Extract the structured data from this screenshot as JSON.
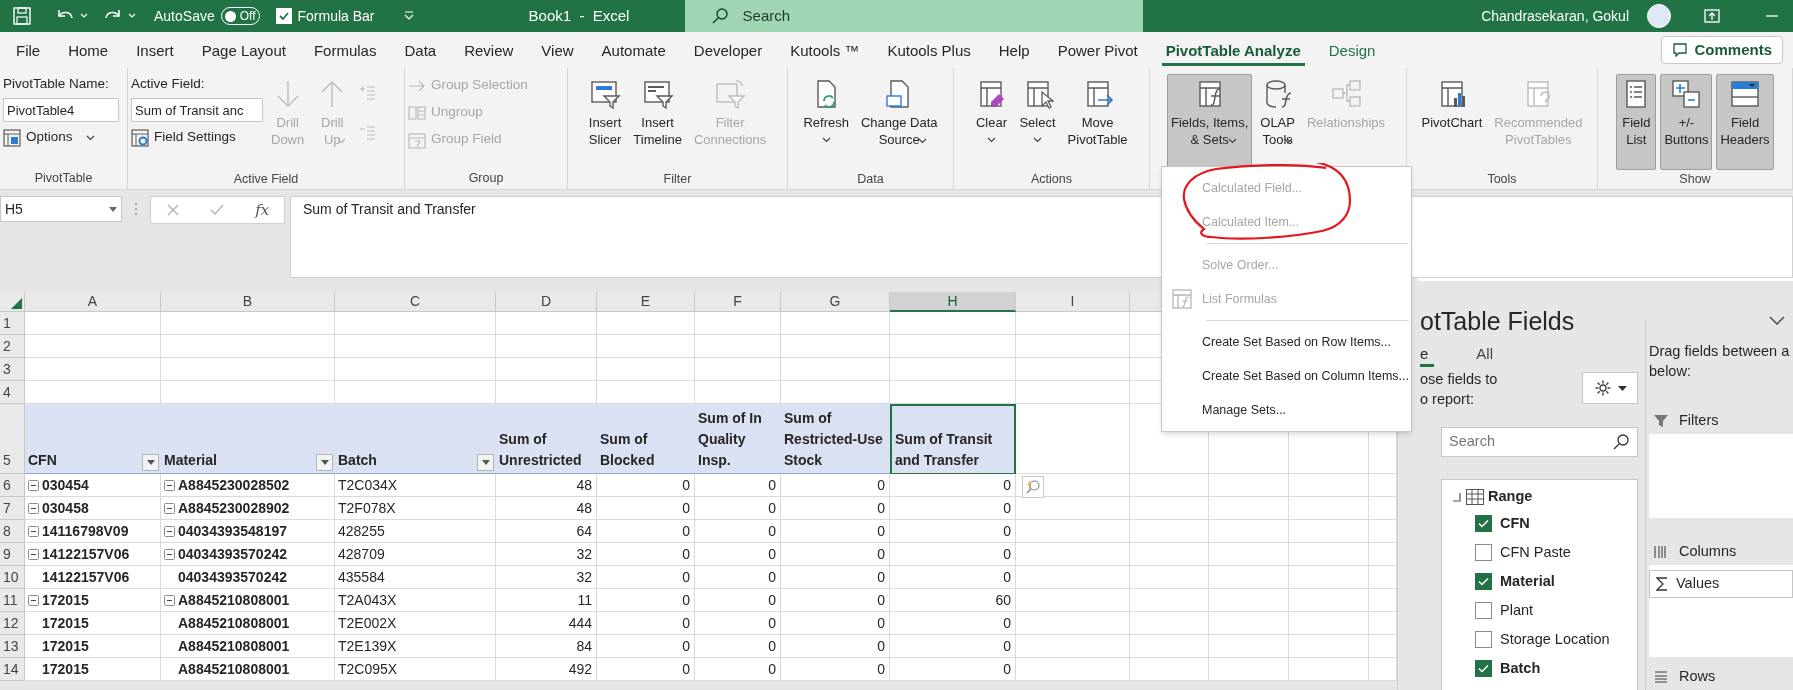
{
  "title_bar": {
    "autosave_label": "AutoSave",
    "autosave_state": "Off",
    "autosave_on": false,
    "formula_bar_label": "Formula Bar",
    "formula_bar_checked": true,
    "title": "Book1  -  Excel",
    "search_placeholder": "Search",
    "user_name": "Chandrasekaran, Gokul"
  },
  "tabs": [
    {
      "label": "File",
      "selected": false,
      "contextual": false
    },
    {
      "label": "Home",
      "selected": false,
      "contextual": false
    },
    {
      "label": "Insert",
      "selected": false,
      "contextual": false
    },
    {
      "label": "Page Layout",
      "selected": false,
      "contextual": false
    },
    {
      "label": "Formulas",
      "selected": false,
      "contextual": false
    },
    {
      "label": "Data",
      "selected": false,
      "contextual": false
    },
    {
      "label": "Review",
      "selected": false,
      "contextual": false
    },
    {
      "label": "View",
      "selected": false,
      "contextual": false
    },
    {
      "label": "Automate",
      "selected": false,
      "contextual": false
    },
    {
      "label": "Developer",
      "selected": false,
      "contextual": false
    },
    {
      "label": "Kutools ™",
      "selected": false,
      "contextual": false
    },
    {
      "label": "Kutools Plus",
      "selected": false,
      "contextual": false
    },
    {
      "label": "Help",
      "selected": false,
      "contextual": false
    },
    {
      "label": "Power Pivot",
      "selected": false,
      "contextual": false
    },
    {
      "label": "PivotTable Analyze",
      "selected": true,
      "contextual": true
    },
    {
      "label": "Design",
      "selected": false,
      "contextual": true
    }
  ],
  "comments_button": "Comments",
  "ribbon": {
    "groups": [
      {
        "label": "PivotTable",
        "items": [
          {
            "kind": "stack",
            "items": [
              {
                "kind": "caption",
                "text": "PivotTable Name:"
              },
              {
                "kind": "input",
                "value": "PivotTable4"
              },
              {
                "kind": "small-button",
                "label": "Options",
                "menu": true,
                "disabled": false
              }
            ]
          }
        ]
      },
      {
        "label": "Active Field",
        "items": [
          {
            "kind": "stack",
            "items": [
              {
                "kind": "caption",
                "text": "Active Field:"
              },
              {
                "kind": "input",
                "value": "Sum of Transit anc"
              },
              {
                "kind": "small-button",
                "label": "Field Settings",
                "menu": false,
                "disabled": false
              }
            ]
          },
          {
            "kind": "large",
            "label": "Drill\nDown",
            "menu": false,
            "disabled": true,
            "pressed": false
          },
          {
            "kind": "large",
            "label": "Drill\nUp",
            "menu": true,
            "disabled": true,
            "pressed": false
          },
          {
            "kind": "stack",
            "items": [
              {
                "kind": "icon-button",
                "disabled": true
              },
              {
                "kind": "icon-button",
                "disabled": true
              }
            ]
          }
        ]
      },
      {
        "label": "Group",
        "items": [
          {
            "kind": "stack",
            "items": [
              {
                "kind": "small-button",
                "label": "Group Selection",
                "menu": false,
                "disabled": true
              },
              {
                "kind": "small-button",
                "label": "Ungroup",
                "menu": false,
                "disabled": true
              },
              {
                "kind": "small-button",
                "label": "Group Field",
                "menu": false,
                "disabled": true
              }
            ]
          }
        ]
      },
      {
        "label": "Filter",
        "items": [
          {
            "kind": "large",
            "label": "Insert\nSlicer",
            "menu": false,
            "disabled": false,
            "pressed": false
          },
          {
            "kind": "large",
            "label": "Insert\nTimeline",
            "menu": false,
            "disabled": false,
            "pressed": false
          },
          {
            "kind": "large",
            "label": "Filter\nConnections",
            "menu": false,
            "disabled": true,
            "pressed": false
          }
        ]
      },
      {
        "label": "Data",
        "items": [
          {
            "kind": "large",
            "label": "Refresh",
            "menu": true,
            "disabled": false,
            "pressed": false
          },
          {
            "kind": "large",
            "label": "Change Data\nSource",
            "menu": true,
            "disabled": false,
            "pressed": false
          }
        ]
      },
      {
        "label": "Actions",
        "items": [
          {
            "kind": "large",
            "label": "Clear",
            "menu": true,
            "disabled": false,
            "pressed": false
          },
          {
            "kind": "large",
            "label": "Select",
            "menu": true,
            "disabled": false,
            "pressed": false
          },
          {
            "kind": "large",
            "label": "Move\nPivotTable",
            "menu": false,
            "disabled": false,
            "pressed": false
          }
        ]
      },
      {
        "items": [
          {
            "kind": "large",
            "label": "Fields, Items,\n& Sets",
            "menu": true,
            "disabled": false,
            "pressed": true
          },
          {
            "kind": "large",
            "label": "OLAP\nTools",
            "menu": true,
            "disabled": false,
            "pressed": false
          },
          {
            "kind": "large",
            "label": "Relationships",
            "menu": false,
            "disabled": true,
            "pressed": false
          }
        ]
      },
      {
        "label": "Tools",
        "items": [
          {
            "kind": "large",
            "label": "PivotChart",
            "menu": false,
            "disabled": false,
            "pressed": false
          },
          {
            "kind": "large",
            "label": "Recommended\nPivotTables",
            "menu": false,
            "disabled": true,
            "pressed": false
          }
        ]
      },
      {
        "label": "Show",
        "items": [
          {
            "kind": "large",
            "label": "Field\nList",
            "menu": false,
            "disabled": false,
            "pressed": true
          },
          {
            "kind": "large",
            "label": "+/-\nButtons",
            "menu": false,
            "disabled": false,
            "pressed": true
          },
          {
            "kind": "large",
            "label": "Field\nHeaders",
            "menu": false,
            "disabled": false,
            "pressed": true
          }
        ]
      }
    ]
  },
  "formula_bar": {
    "name_box": "H5",
    "fx_label": "fx",
    "formula": "Sum of Transit and Transfer"
  },
  "grid": {
    "columns": [
      {
        "letter": "A",
        "selected": false
      },
      {
        "letter": "B",
        "selected": false
      },
      {
        "letter": "C",
        "selected": false
      },
      {
        "letter": "D",
        "selected": false
      },
      {
        "letter": "E",
        "selected": false
      },
      {
        "letter": "F",
        "selected": false
      },
      {
        "letter": "G",
        "selected": false
      },
      {
        "letter": "H",
        "selected": true
      },
      {
        "letter": "I",
        "selected": false
      }
    ],
    "empty_rows": [
      "1",
      "2",
      "3",
      "4"
    ],
    "header_row": {
      "number": "5",
      "cells": [
        {
          "text": "CFN",
          "filter": true,
          "selected": false
        },
        {
          "text": "Material",
          "filter": true,
          "selected": false
        },
        {
          "text": "Batch",
          "filter": true,
          "selected": false
        },
        {
          "text": "Sum of Unrestricted",
          "filter": false,
          "selected": false
        },
        {
          "text": "Sum of Blocked",
          "filter": false,
          "selected": false
        },
        {
          "text": "Sum of In Quality Insp.",
          "filter": false,
          "selected": false
        },
        {
          "text": "Sum of Restricted-Use Stock",
          "filter": false,
          "selected": false
        },
        {
          "text": "Sum of Transit and Transfer",
          "filter": false,
          "selected": true
        }
      ]
    },
    "rows": [
      {
        "number": "6",
        "cells": [
          {
            "kind": "row-label",
            "text": "030454",
            "collapse": true
          },
          {
            "kind": "row-label",
            "text": "A8845230028502",
            "collapse": true
          },
          {
            "kind": "text",
            "text": "T2C034X"
          },
          {
            "kind": "number",
            "text": "48"
          },
          {
            "kind": "number",
            "text": "0"
          },
          {
            "kind": "number",
            "text": "0"
          },
          {
            "kind": "number",
            "text": "0"
          },
          {
            "kind": "number",
            "text": "0"
          }
        ]
      },
      {
        "number": "7",
        "cells": [
          {
            "kind": "row-label",
            "text": "030458",
            "collapse": true
          },
          {
            "kind": "row-label",
            "text": "A8845230028902",
            "collapse": true
          },
          {
            "kind": "text",
            "text": "T2F078X"
          },
          {
            "kind": "number",
            "text": "48"
          },
          {
            "kind": "number",
            "text": "0"
          },
          {
            "kind": "number",
            "text": "0"
          },
          {
            "kind": "number",
            "text": "0"
          },
          {
            "kind": "number",
            "text": "0"
          }
        ]
      },
      {
        "number": "8",
        "cells": [
          {
            "kind": "row-label",
            "text": "14116798V09",
            "collapse": true
          },
          {
            "kind": "row-label",
            "text": "04034393548197",
            "collapse": true
          },
          {
            "kind": "text",
            "text": "428255"
          },
          {
            "kind": "number",
            "text": "64"
          },
          {
            "kind": "number",
            "text": "0"
          },
          {
            "kind": "number",
            "text": "0"
          },
          {
            "kind": "number",
            "text": "0"
          },
          {
            "kind": "number",
            "text": "0"
          }
        ]
      },
      {
        "number": "9",
        "cells": [
          {
            "kind": "row-label",
            "text": "14122157V06",
            "collapse": true
          },
          {
            "kind": "row-label",
            "text": "04034393570242",
            "collapse": true
          },
          {
            "kind": "text",
            "text": "428709"
          },
          {
            "kind": "number",
            "text": "32"
          },
          {
            "kind": "number",
            "text": "0"
          },
          {
            "kind": "number",
            "text": "0"
          },
          {
            "kind": "number",
            "text": "0"
          },
          {
            "kind": "number",
            "text": "0"
          }
        ]
      },
      {
        "number": "10",
        "cells": [
          {
            "kind": "row-label",
            "text": "14122157V06",
            "collapse": false
          },
          {
            "kind": "row-label",
            "text": "04034393570242",
            "collapse": false
          },
          {
            "kind": "text",
            "text": "435584"
          },
          {
            "kind": "number",
            "text": "32"
          },
          {
            "kind": "number",
            "text": "0"
          },
          {
            "kind": "number",
            "text": "0"
          },
          {
            "kind": "number",
            "text": "0"
          },
          {
            "kind": "number",
            "text": "0"
          }
        ]
      },
      {
        "number": "11",
        "cells": [
          {
            "kind": "row-label",
            "text": "172015",
            "collapse": true
          },
          {
            "kind": "row-label",
            "text": "A8845210808001",
            "collapse": true
          },
          {
            "kind": "text",
            "text": "T2A043X"
          },
          {
            "kind": "number",
            "text": "11"
          },
          {
            "kind": "number",
            "text": "0"
          },
          {
            "kind": "number",
            "text": "0"
          },
          {
            "kind": "number",
            "text": "0"
          },
          {
            "kind": "number",
            "text": "60"
          }
        ]
      },
      {
        "number": "12",
        "cells": [
          {
            "kind": "row-label",
            "text": "172015",
            "collapse": false
          },
          {
            "kind": "row-label",
            "text": "A8845210808001",
            "collapse": false
          },
          {
            "kind": "text",
            "text": "T2E002X"
          },
          {
            "kind": "number",
            "text": "444"
          },
          {
            "kind": "number",
            "text": "0"
          },
          {
            "kind": "number",
            "text": "0"
          },
          {
            "kind": "number",
            "text": "0"
          },
          {
            "kind": "number",
            "text": "0"
          }
        ]
      },
      {
        "number": "13",
        "cells": [
          {
            "kind": "row-label",
            "text": "172015",
            "collapse": false
          },
          {
            "kind": "row-label",
            "text": "A8845210808001",
            "collapse": false
          },
          {
            "kind": "text",
            "text": "T2E139X"
          },
          {
            "kind": "number",
            "text": "84"
          },
          {
            "kind": "number",
            "text": "0"
          },
          {
            "kind": "number",
            "text": "0"
          },
          {
            "kind": "number",
            "text": "0"
          },
          {
            "kind": "number",
            "text": "0"
          }
        ]
      },
      {
        "number": "14",
        "cells": [
          {
            "kind": "row-label",
            "text": "172015",
            "collapse": false
          },
          {
            "kind": "row-label",
            "text": "A8845210808001",
            "collapse": false
          },
          {
            "kind": "text",
            "text": "T2C095X"
          },
          {
            "kind": "number",
            "text": "492"
          },
          {
            "kind": "number",
            "text": "0"
          },
          {
            "kind": "number",
            "text": "0"
          },
          {
            "kind": "number",
            "text": "0"
          },
          {
            "kind": "number",
            "text": "0"
          }
        ]
      }
    ]
  },
  "fields_menu": [
    {
      "kind": "item",
      "label": "Calculated Field...",
      "disabled": true,
      "icon": false
    },
    {
      "kind": "item",
      "label": "Calculated Item...",
      "disabled": true,
      "icon": false
    },
    {
      "kind": "separator"
    },
    {
      "kind": "item",
      "label": "Solve Order...",
      "disabled": true,
      "icon": false
    },
    {
      "kind": "item",
      "label": "List Formulas",
      "disabled": true,
      "icon": true
    },
    {
      "kind": "separator"
    },
    {
      "kind": "item",
      "label": "Create Set Based on Row Items...",
      "disabled": false,
      "icon": false
    },
    {
      "kind": "item",
      "label": "Create Set Based on Column Items...",
      "disabled": false,
      "icon": false
    },
    {
      "kind": "item",
      "label": "Manage Sets...",
      "disabled": false,
      "icon": false
    }
  ],
  "pivot_pane": {
    "title": "otTable Fields",
    "tabs": [
      {
        "label": "e",
        "selected": true
      },
      {
        "label": "All",
        "selected": false
      }
    ],
    "choose_lines": [
      "ose fields to",
      "o report:"
    ],
    "search_placeholder": "Search",
    "field_tree": {
      "label": "Range",
      "children": [
        {
          "label": "CFN",
          "checked": true
        },
        {
          "label": "CFN Paste",
          "checked": false
        },
        {
          "label": "Material",
          "checked": true
        },
        {
          "label": "Plant",
          "checked": false
        },
        {
          "label": "Storage Location",
          "checked": false
        },
        {
          "label": "Batch",
          "checked": true
        }
      ]
    },
    "drag_lines": [
      "Drag fields between a",
      "below:"
    ],
    "areas": [
      {
        "kind": "filters",
        "label": "Filters"
      },
      {
        "kind": "columns",
        "label": "Columns",
        "items": [
          "Values"
        ]
      },
      {
        "kind": "rows",
        "label": "Rows"
      }
    ]
  }
}
